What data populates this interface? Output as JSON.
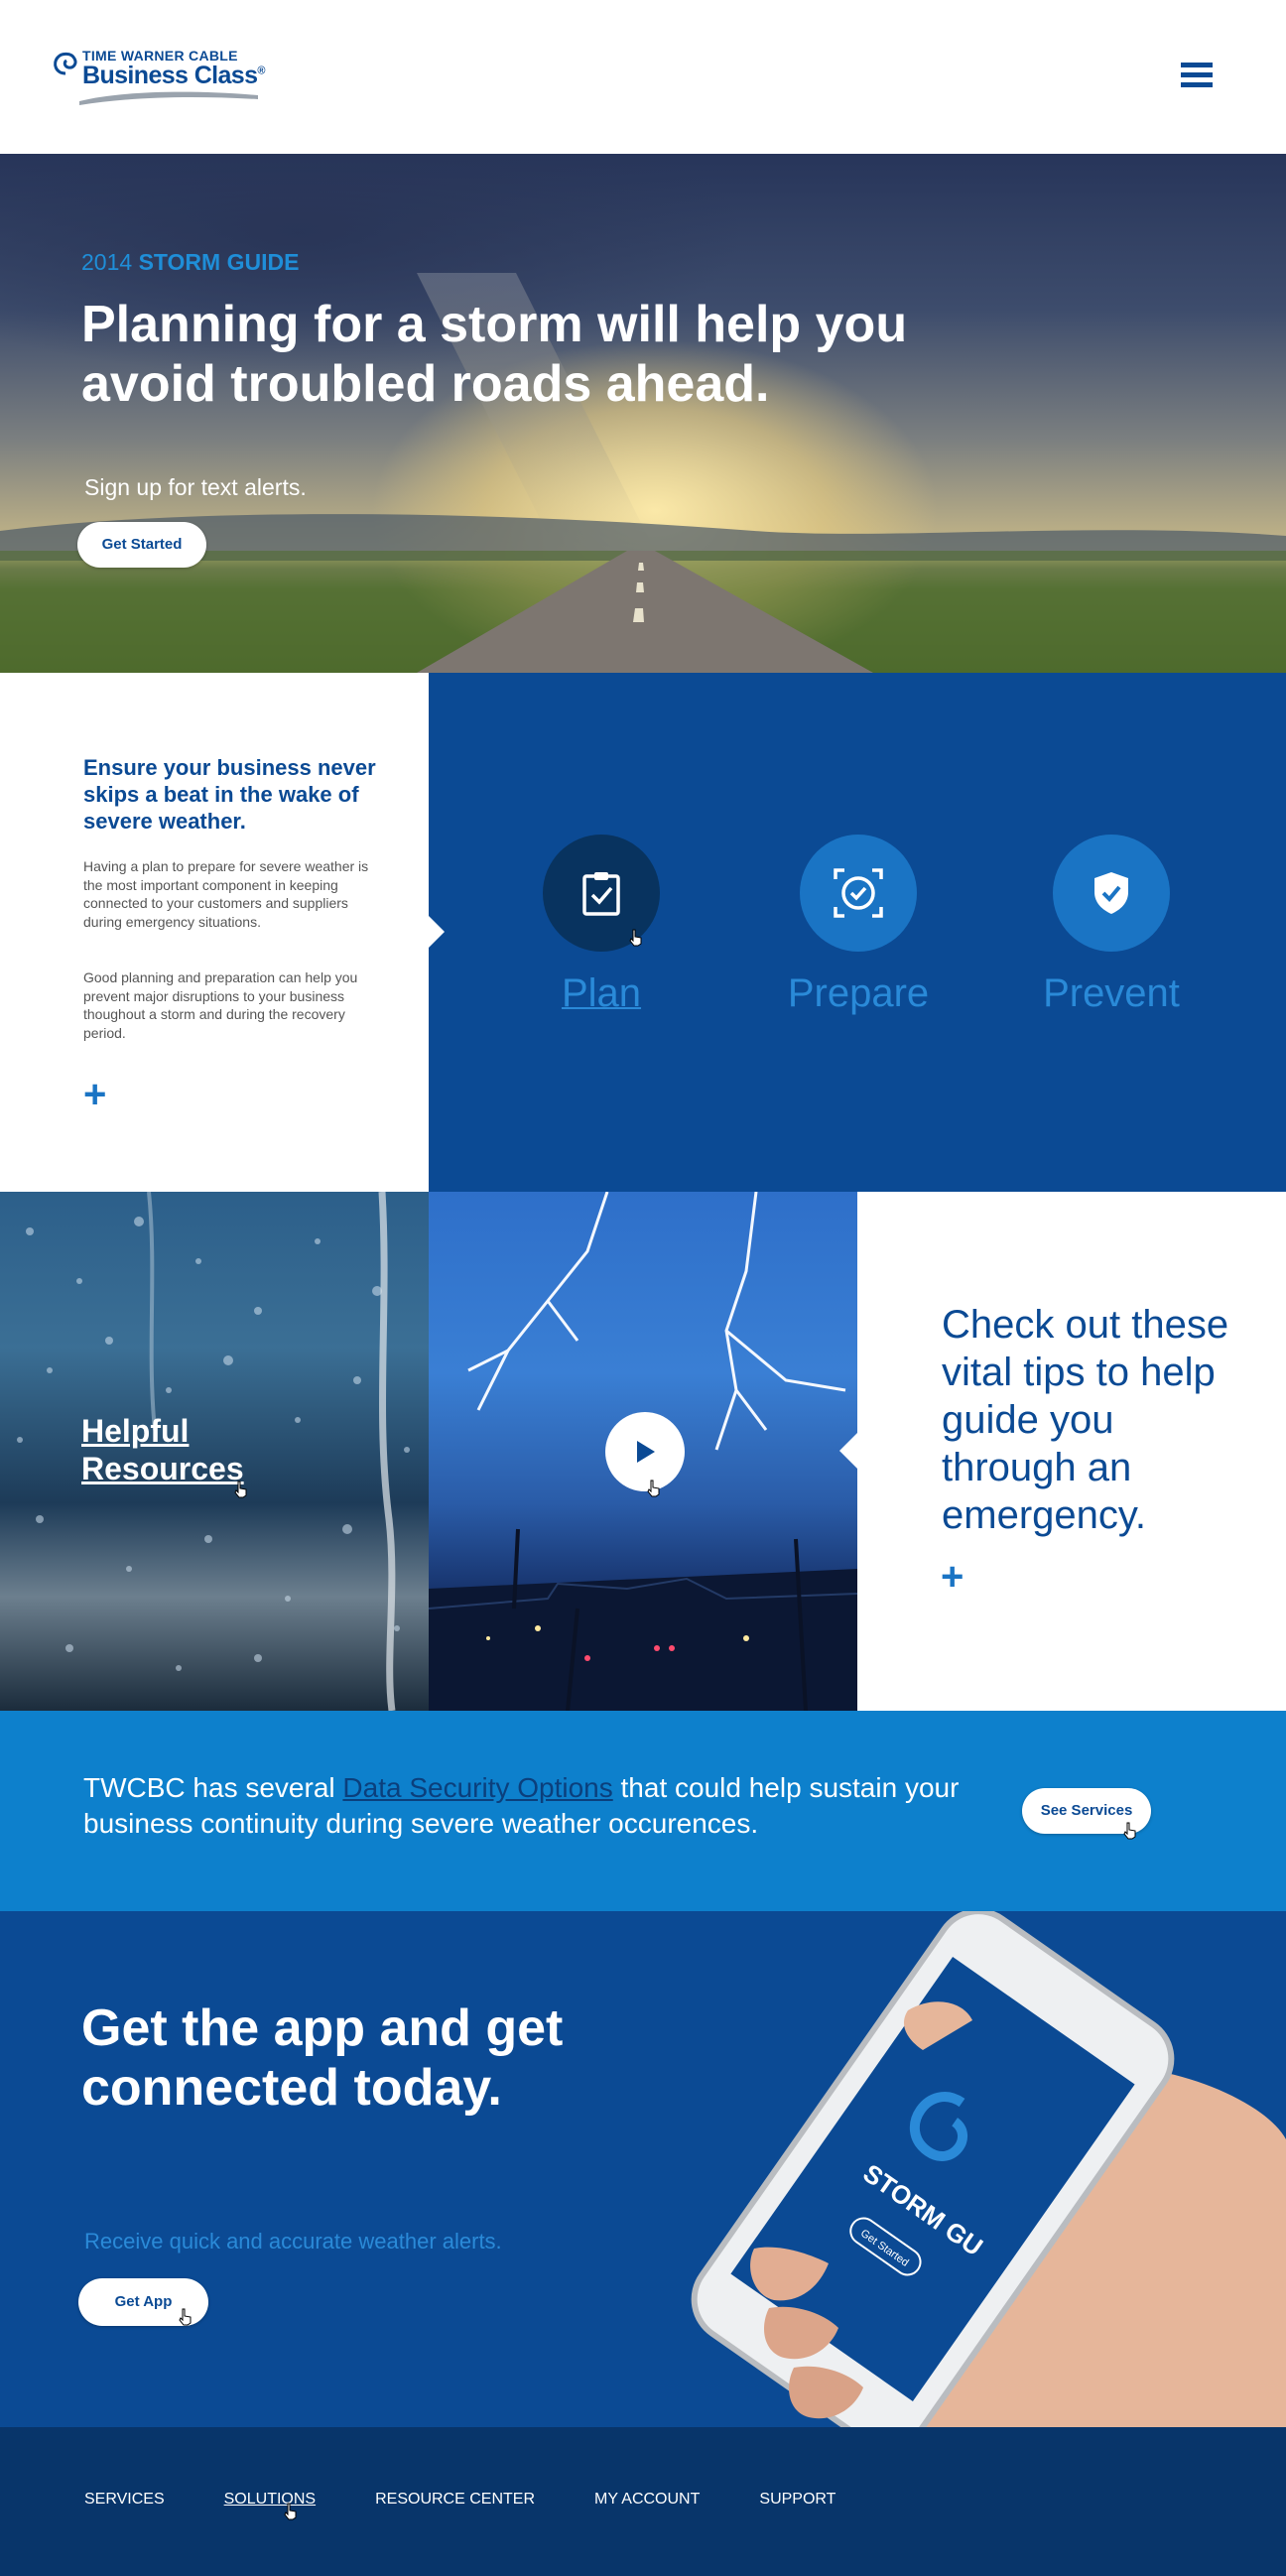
{
  "brand": {
    "name_top": "TIME WARNER CABLE",
    "name_main": "Business Class",
    "registered": "®"
  },
  "header": {
    "menu_icon": "hamburger-menu-icon"
  },
  "hero": {
    "year": "2014",
    "eyebrow": "STORM GUIDE",
    "title": "Planning for a storm will help you avoid troubled roads ahead.",
    "subtitle": "Sign up for text alerts.",
    "button_label": "Get Started"
  },
  "intro": {
    "title": "Ensure your business never skips a beat in the wake of severe weather.",
    "paragraph1": "Having a plan to prepare for severe weather is the most important component in keeping connected to your customers and suppliers during emergency situations.",
    "paragraph2": "Good planning and preparation can help you prevent major disruptions to your business thoughout a storm and during the recovery period.",
    "expand_symbol": "+"
  },
  "steps": [
    {
      "label": "Plan",
      "icon": "clipboard-check-icon",
      "active": true
    },
    {
      "label": "Prepare",
      "icon": "target-check-icon",
      "active": false
    },
    {
      "label": "Prevent",
      "icon": "shield-check-icon",
      "active": false
    }
  ],
  "resources": {
    "link_line1": "Helpful",
    "link_line2": "Resources",
    "video_icon": "play-icon",
    "tips_text": "Check out these vital tips to help guide you through an emergency.",
    "expand_symbol": "+"
  },
  "security_band": {
    "text_before": "TWCBC has several ",
    "link_text": "Data Security Options",
    "text_after": " that could help sustain your business continuity during severe weather occurences.",
    "button_label": "See Services"
  },
  "app": {
    "title": "Get the app and get connected today.",
    "subtitle": "Receive quick and accurate weather alerts.",
    "button_label": "Get App",
    "screen_title": "STORM GU",
    "screen_button": "Get Started"
  },
  "footer": {
    "nav": [
      "SERVICES",
      "SOLUTIONS",
      "RESOURCE CENTER",
      "MY ACCOUNT",
      "SUPPORT"
    ],
    "active_index": 1
  },
  "colors": {
    "brand_blue": "#0b4a94",
    "accent_blue": "#1a74c4",
    "band_blue": "#0d80cc",
    "footer_navy": "#08356a"
  }
}
